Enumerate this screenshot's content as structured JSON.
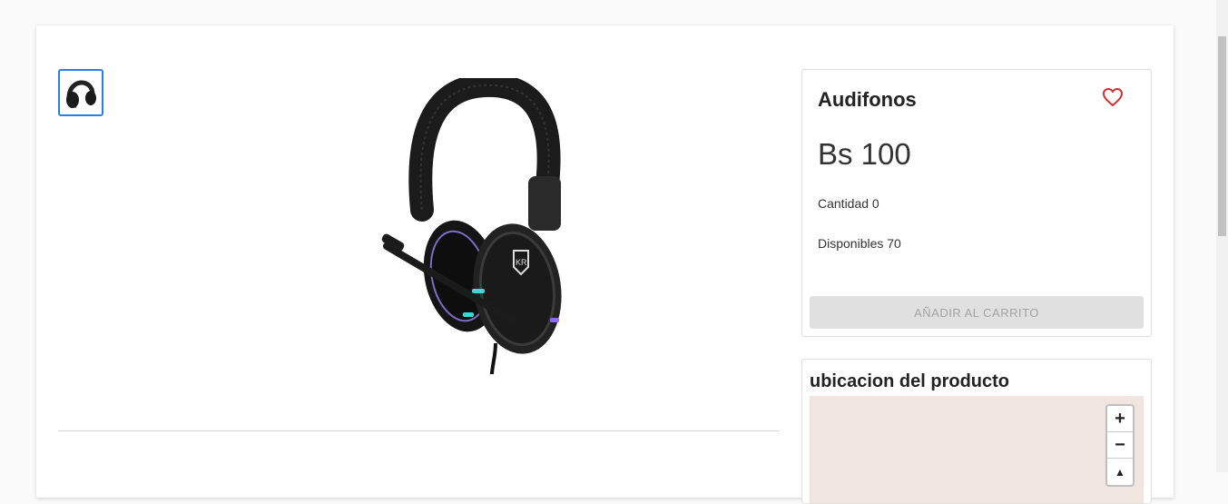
{
  "product": {
    "title": "Audifonos",
    "price": "Bs 100",
    "quantity_label": "Cantidad 0",
    "available_label": "Disponibles 70",
    "add_to_cart_label": "AÑADIR AL CARRITO"
  },
  "location": {
    "title": "ubicacion del producto",
    "zoom_in": "+",
    "zoom_out": "−",
    "reset_north": "▲"
  },
  "colors": {
    "accent": "#2f7de1",
    "heart": "#d32f2f",
    "disabled_button": "#e0e0e0",
    "map_background": "#f0e6df"
  },
  "icons": [
    "favorite-heart-icon",
    "headphones-image"
  ]
}
